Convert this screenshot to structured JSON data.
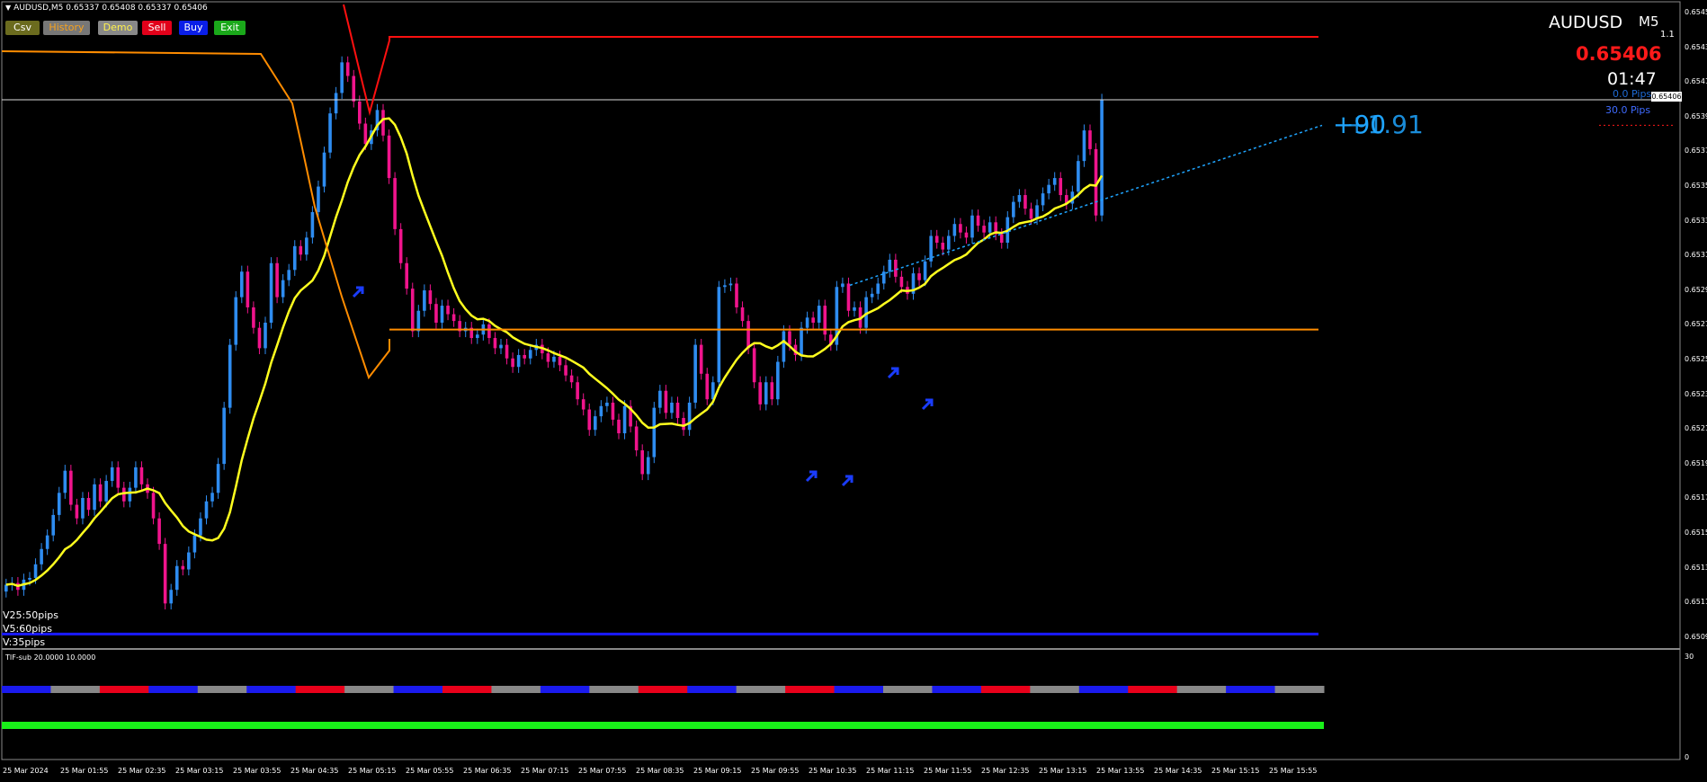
{
  "header": {
    "symbol_info": "AUDUSD,M5  0.65337 0.65408 0.65337 0.65406"
  },
  "buttons": {
    "csv": "Csv",
    "history": "History",
    "demo": "Demo",
    "sell": "Sell",
    "buy": "Buy",
    "exit": "Exit"
  },
  "panel": {
    "symbol": "AUDUSD",
    "timeframe": "M5",
    "timeframe_value": "1.1",
    "bid": "0.65406",
    "timer": "01:47",
    "pips_0": "0.0 Pips",
    "pips_30": "30.0 Pips",
    "big_label_a": "+90",
    "big_label_b": "+1.91"
  },
  "volume_labels": {
    "v25": "V25:50pips",
    "v5": "V5:60pips",
    "v": "V:35pips"
  },
  "sub_window": {
    "label": "TIF-sub 20.0000 10.0000",
    "scale_top": "30",
    "scale_bottom": "0"
  },
  "current_price_box": "0.65406",
  "price_scale": [
    "0.65455",
    "0.65435",
    "0.65415",
    "0.65395",
    "0.65375",
    "0.65355",
    "0.65335",
    "0.65315",
    "0.65295",
    "0.65275",
    "0.65255",
    "0.65235",
    "0.65215",
    "0.65195",
    "0.65175",
    "0.65155",
    "0.65135",
    "0.65115",
    "0.65095"
  ],
  "time_labels": [
    "25 Mar 2024",
    "25 Mar 01:55",
    "25 Mar 02:35",
    "25 Mar 03:15",
    "25 Mar 03:55",
    "25 Mar 04:35",
    "25 Mar 05:15",
    "25 Mar 05:55",
    "25 Mar 06:35",
    "25 Mar 07:15",
    "25 Mar 07:55",
    "25 Mar 08:35",
    "25 Mar 09:15",
    "25 Mar 09:55",
    "25 Mar 10:35",
    "25 Mar 11:15",
    "25 Mar 11:55",
    "25 Mar 12:35",
    "25 Mar 13:15",
    "25 Mar 13:55",
    "25 Mar 14:35",
    "25 Mar 15:15",
    "25 Mar 15:55"
  ],
  "colors": {
    "bull": "#2e8cf0",
    "bear": "#f0148c",
    "ma": "#ffff1e",
    "resist": "#ff1010",
    "support": "#ff8c00",
    "bg": "#000000"
  },
  "chart_data": {
    "type": "candlestick",
    "price_range": [
      0.65088,
      0.65462
    ],
    "ohlc_close": [
      0.65121,
      0.65122,
      0.65118,
      0.65124,
      0.65125,
      0.65133,
      0.65142,
      0.6515,
      0.65162,
      0.65175,
      0.65188,
      0.65168,
      0.6516,
      0.65172,
      0.65165,
      0.6518,
      0.6517,
      0.65182,
      0.6519,
      0.65178,
      0.6517,
      0.65178,
      0.6519,
      0.6518,
      0.65175,
      0.6516,
      0.65145,
      0.6511,
      0.65118,
      0.65132,
      0.6513,
      0.6514,
      0.6515,
      0.6516,
      0.6517,
      0.65175,
      0.65192,
      0.65225,
      0.65262,
      0.6529,
      0.65305,
      0.65284,
      0.65272,
      0.6526,
      0.65275,
      0.6531,
      0.6529,
      0.653,
      0.65306,
      0.6532,
      0.65315,
      0.65325,
      0.6534,
      0.65355,
      0.65375,
      0.65398,
      0.6541,
      0.65428,
      0.6542,
      0.65405,
      0.65392,
      0.6538,
      0.65388,
      0.654,
      0.65385,
      0.6536,
      0.6533,
      0.6531,
      0.65295,
      0.6527,
      0.65282,
      0.65294,
      0.65286,
      0.65275,
      0.65285,
      0.6528,
      0.65276,
      0.6527,
      0.65272,
      0.65266,
      0.65268,
      0.65274,
      0.65266,
      0.6526,
      0.65262,
      0.65254,
      0.65249,
      0.65256,
      0.65254,
      0.65259,
      0.65262,
      0.65257,
      0.65252,
      0.65255,
      0.6525,
      0.65244,
      0.6524,
      0.6523,
      0.65224,
      0.65212,
      0.6522,
      0.65226,
      0.65228,
      0.65218,
      0.6521,
      0.65226,
      0.65214,
      0.652,
      0.65186,
      0.65196,
      0.65225,
      0.65235,
      0.65222,
      0.65228,
      0.65219,
      0.65212,
      0.65228,
      0.65262,
      0.65245,
      0.6523,
      0.6524,
      0.65296,
      0.65297,
      0.65298,
      0.65284,
      0.65276,
      0.6526,
      0.6524,
      0.65227,
      0.6524,
      0.6523,
      0.65252,
      0.6527,
      0.65262,
      0.65256,
      0.65272,
      0.65278,
      0.65275,
      0.65285,
      0.65268,
      0.65262,
      0.65296,
      0.65298,
      0.65282,
      0.65284,
      0.65272,
      0.6529,
      0.65292,
      0.65298,
      0.65305,
      0.65312,
      0.65302,
      0.65296,
      0.65292,
      0.65304,
      0.653,
      0.65311,
      0.65326,
      0.65322,
      0.65318,
      0.65326,
      0.65333,
      0.65328,
      0.65325,
      0.65338,
      0.65332,
      0.65328,
      0.65334,
      0.65327,
      0.65322,
      0.65337,
      0.65346,
      0.6535,
      0.65342,
      0.65336,
      0.65344,
      0.65351,
      0.65356,
      0.6536,
      0.6535,
      0.65345,
      0.65352,
      0.6537,
      0.65388,
      0.65377,
      0.65338,
      0.65406
    ],
    "ma_label": "yellow MA",
    "resistance_level": 0.65443,
    "support_level": 0.65271,
    "current_price": 0.65406,
    "bottom_level": 0.65092
  }
}
